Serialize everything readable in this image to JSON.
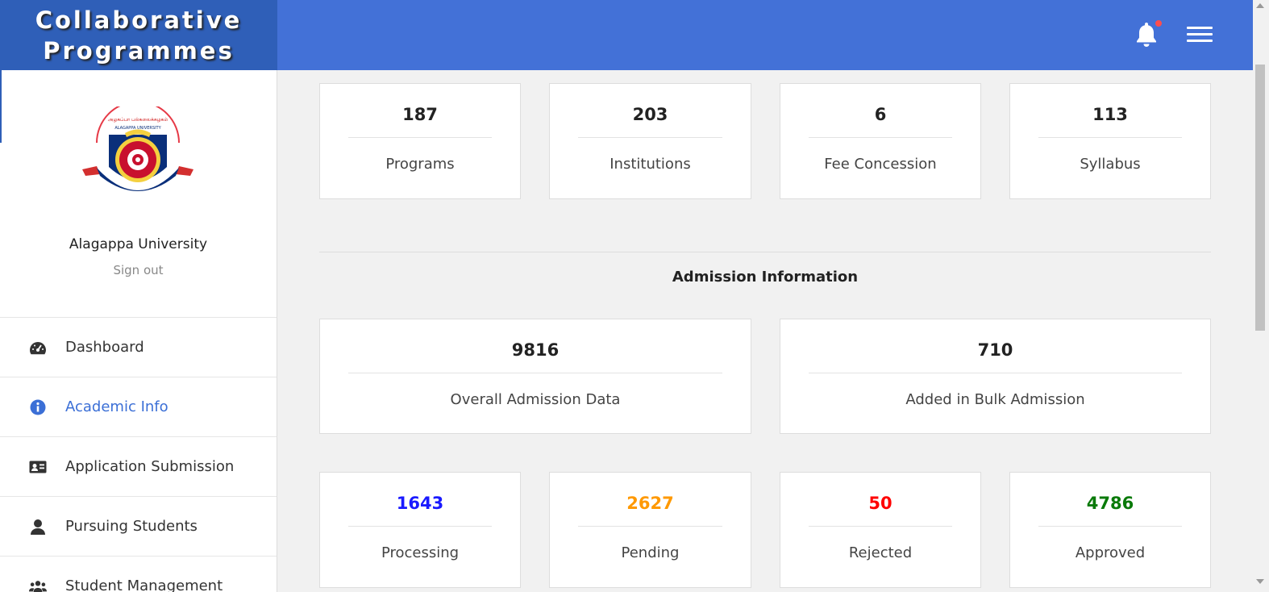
{
  "brand": {
    "line1": "Collaborative",
    "line2": "Programmes"
  },
  "profile": {
    "name": "Alagappa University",
    "signout": "Sign out"
  },
  "menu": [
    {
      "label": "Dashboard",
      "icon": "dashboard-icon",
      "active": false
    },
    {
      "label": "Academic Info",
      "icon": "info-icon",
      "active": true
    },
    {
      "label": "Application Submission",
      "icon": "id-card-icon",
      "active": false
    },
    {
      "label": "Pursuing Students",
      "icon": "user-icon",
      "active": false
    },
    {
      "label": "Student Management",
      "icon": "users-icon",
      "active": false
    }
  ],
  "stats": [
    {
      "value": "187",
      "label": "Programs"
    },
    {
      "value": "203",
      "label": "Institutions"
    },
    {
      "value": "6",
      "label": "Fee Concession"
    },
    {
      "value": "113",
      "label": "Syllabus"
    }
  ],
  "admission": {
    "title": "Admission Information",
    "overall": {
      "value": "9816",
      "label": "Overall Admission Data"
    },
    "bulk": {
      "value": "710",
      "label": "Added in Bulk Admission"
    }
  },
  "status": [
    {
      "value": "1643",
      "label": "Processing",
      "color": "#1a1aff"
    },
    {
      "value": "2627",
      "label": "Pending",
      "color": "#ff9900"
    },
    {
      "value": "50",
      "label": "Rejected",
      "color": "#ff0000"
    },
    {
      "value": "4786",
      "label": "Approved",
      "color": "#0a7a0a"
    }
  ],
  "colors": {
    "header": "#4371d7",
    "brand": "#2f5fb8",
    "accent": "#3b6fd6"
  }
}
